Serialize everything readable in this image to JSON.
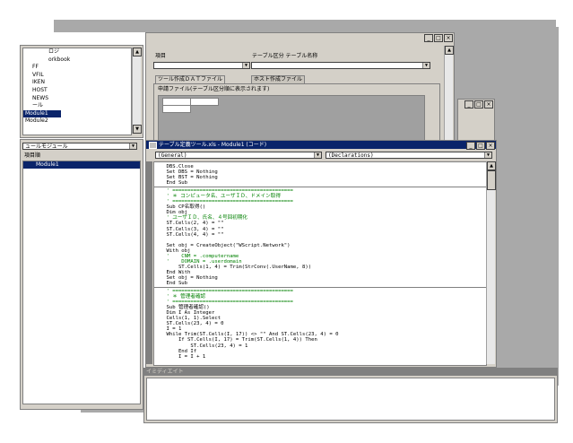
{
  "project_panel": {
    "items": [
      "ロジ",
      "orkbook",
      "FF",
      "VFIL",
      "IKEN",
      "HOST",
      "NEWS",
      "ール",
      "Module1",
      "Module2"
    ]
  },
  "properties_panel": {
    "dropdown": "ュールモジュール",
    "tab": "項目順",
    "row_name": "Module1"
  },
  "form_window": {
    "label_left": "項目",
    "label_right": "テーブル区分 テーブル名称",
    "tabs": [
      "ツール作成ＤＡＴファイル",
      "ホスト作成ファイル"
    ],
    "field_label": "申請ファイル(テーブル区分順に表示されます)"
  },
  "code_window": {
    "title": "テーブル定義ツール.xls - Module1 (コード)",
    "object_combo": "(General)",
    "proc_combo": "(Declarations)",
    "lines": [
      {
        "t": "    DBS.Close",
        "c": false
      },
      {
        "t": "    Set DBS = Nothing",
        "c": false
      },
      {
        "t": "    Set BST = Nothing",
        "c": false
      },
      {
        "t": "    End Sub",
        "c": false
      },
      {
        "t": "    ' ========================================",
        "c": true,
        "sep": true
      },
      {
        "t": "    ' ＊ コンピュータ名、ユーザＩＤ、ドメイン取得",
        "c": true
      },
      {
        "t": "    ' ========================================",
        "c": true
      },
      {
        "t": "    Sub CP名取得()",
        "c": false
      },
      {
        "t": "    Dim obj",
        "c": false
      },
      {
        "t": "    ' ユーザＩＤ、氏名、４号回初期化",
        "c": true
      },
      {
        "t": "    ST.Cells(2, 4) = \"\"",
        "c": false
      },
      {
        "t": "    ST.Cells(3, 4) = \"\"",
        "c": false
      },
      {
        "t": "    ST.Cells(4, 4) = \"\"",
        "c": false
      },
      {
        "t": "",
        "c": false
      },
      {
        "t": "    Set obj = CreateObject(\"WScript.Network\")",
        "c": false
      },
      {
        "t": "    With obj",
        "c": false
      },
      {
        "t": "    '    CNM = .computername",
        "c": true
      },
      {
        "t": "    '    DOMAIN = .userdomain",
        "c": true
      },
      {
        "t": "        ST.Cells(1, 4) = Trim(StrConv(.UserName, 8))",
        "c": false
      },
      {
        "t": "    End With",
        "c": false
      },
      {
        "t": "    Set obj = Nothing",
        "c": false
      },
      {
        "t": "    End Sub",
        "c": false
      },
      {
        "t": "    ' ========================================",
        "c": true,
        "sep": true
      },
      {
        "t": "    ' ＊ 管理者確認",
        "c": true
      },
      {
        "t": "    ' ========================================",
        "c": true
      },
      {
        "t": "    Sub 管理者確認()",
        "c": false
      },
      {
        "t": "    Dim I As Integer",
        "c": false
      },
      {
        "t": "    Cells(1, 1).Select",
        "c": false
      },
      {
        "t": "    ST.Cells(23, 4) = 0",
        "c": false
      },
      {
        "t": "    I = 1",
        "c": false
      },
      {
        "t": "    While Trim(ST.Cells(I, 17)) <> \"\" And ST.Cells(23, 4) = 0",
        "c": false
      },
      {
        "t": "        If ST.Cells(I, 17) = Trim(ST.Cells(1, 4)) Then",
        "c": false
      },
      {
        "t": "            ST.Cells(23, 4) = 1",
        "c": false
      },
      {
        "t": "        End If",
        "c": false
      },
      {
        "t": "        I = I + 1",
        "c": false
      }
    ]
  },
  "immediate_window": {
    "title": "イミディエイト"
  },
  "colors": {
    "face": "#d4d0c8",
    "titlebar": "#0a246a",
    "comment": "#008000",
    "shadow": "#a9a9a9"
  }
}
